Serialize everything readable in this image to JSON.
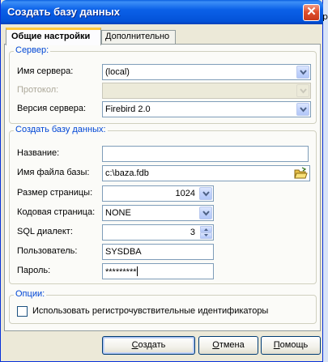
{
  "window": {
    "title": "Создать базу данных",
    "close_glyph": "✕"
  },
  "tabs": [
    {
      "label": "Общие настройки",
      "active": true
    },
    {
      "label": "Дополнительно",
      "active": false
    }
  ],
  "server_group": {
    "title": "Сервер:",
    "server_name_label": "Имя сервера:",
    "server_name_value": "(local)",
    "protocol_label": "Протокол:",
    "protocol_value": "",
    "version_label": "Версия сервера:",
    "version_value": "Firebird 2.0"
  },
  "create_group": {
    "title": "Создать базу данных:",
    "name_label": "Название:",
    "name_value": "",
    "file_label": "Имя файла базы:",
    "file_value": "c:\\baza.fdb",
    "page_size_label": "Размер страницы:",
    "page_size_value": "1024",
    "codepage_label": "Кодовая страница:",
    "codepage_value": "NONE",
    "dialect_label": "SQL диалект:",
    "dialect_value": "3",
    "user_label": "Пользователь:",
    "user_value": "SYSDBA",
    "password_label": "Пароль:",
    "password_value": "*********"
  },
  "options_group": {
    "title": "Опции:",
    "case_sensitive_label": "Использовать регистрочувствительные идентификаторы",
    "case_sensitive_checked": false
  },
  "buttons": {
    "create_ul": "С",
    "create_rest": "оздать",
    "cancel_ul": "О",
    "cancel_rest": "тмена",
    "help_ul": "П",
    "help_rest": "омощь"
  },
  "background": {
    "partial_text": "р"
  },
  "colors": {
    "title_bar": "#0b61e8",
    "group_title": "#0046d5",
    "dialog_bg": "#ece9d8"
  }
}
